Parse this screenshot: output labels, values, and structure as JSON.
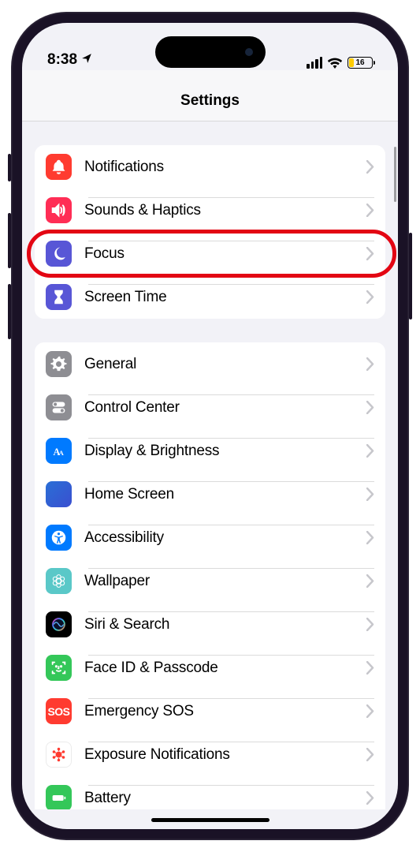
{
  "status_bar": {
    "time": "8:38",
    "battery_percent": "16"
  },
  "page_title": "Settings",
  "group1": {
    "items": [
      {
        "label": "Notifications",
        "icon": "bell-icon",
        "color": "bg-red"
      },
      {
        "label": "Sounds & Haptics",
        "icon": "speaker-icon",
        "color": "bg-pink"
      },
      {
        "label": "Focus",
        "icon": "moon-icon",
        "color": "bg-indigo",
        "highlighted": true
      },
      {
        "label": "Screen Time",
        "icon": "hourglass-icon",
        "color": "bg-indigo"
      }
    ]
  },
  "group2": {
    "items": [
      {
        "label": "General",
        "icon": "gear-icon",
        "color": "bg-gray"
      },
      {
        "label": "Control Center",
        "icon": "toggles-icon",
        "color": "bg-gray"
      },
      {
        "label": "Display & Brightness",
        "icon": "text-size-icon",
        "color": "bg-blue"
      },
      {
        "label": "Home Screen",
        "icon": "home-screen-icon",
        "color": "bg-homescreen"
      },
      {
        "label": "Accessibility",
        "icon": "accessibility-icon",
        "color": "bg-blue"
      },
      {
        "label": "Wallpaper",
        "icon": "wallpaper-icon",
        "color": "bg-teal"
      },
      {
        "label": "Siri & Search",
        "icon": "siri-icon",
        "color": "siri-grad"
      },
      {
        "label": "Face ID & Passcode",
        "icon": "faceid-icon",
        "color": "bg-green"
      },
      {
        "label": "Emergency SOS",
        "icon": "sos-icon",
        "color": "bg-sosred"
      },
      {
        "label": "Exposure Notifications",
        "icon": "exposure-icon",
        "color": "bg-white"
      },
      {
        "label": "Battery",
        "icon": "battery-icon",
        "color": "bg-green"
      }
    ]
  }
}
